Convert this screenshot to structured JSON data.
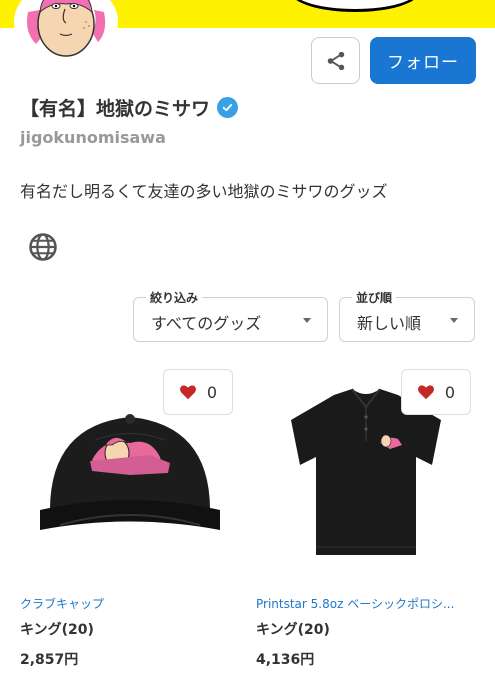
{
  "header": {
    "share_icon": "share-icon",
    "follow_label": "フォロー"
  },
  "shop": {
    "name": "【有名】地獄のミサワ",
    "verified_icon": "check-icon",
    "handle": "jigokunomisawa",
    "description": "有名だし明るくて友達の多い地獄のミサワのグッズ",
    "website_icon": "globe-icon"
  },
  "filters": {
    "filter": {
      "label": "絞り込み",
      "value": "すべてのグッズ"
    },
    "sort": {
      "label": "並び順",
      "value": "新しい順"
    }
  },
  "colors": {
    "banner": "#fff200",
    "accent": "#1976d2",
    "heart": "#c62828",
    "link": "#1e78c8"
  },
  "products": [
    {
      "title": "クラブキャップ",
      "creator": "キング(20)",
      "price": "2,857円",
      "likes": "0",
      "image_icon": "cap-image"
    },
    {
      "title": "Printstar 5.8oz ベーシックポロシ...",
      "creator": "キング(20)",
      "price": "4,136円",
      "likes": "0",
      "image_icon": "polo-shirt-image"
    }
  ]
}
